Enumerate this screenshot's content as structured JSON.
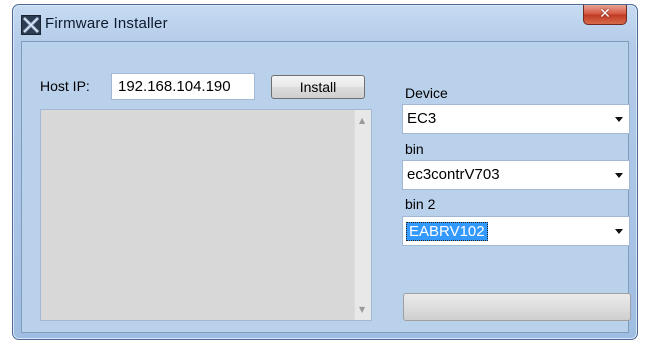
{
  "window": {
    "title": "Firmware Installer",
    "close_glyph": "✕"
  },
  "host": {
    "label": "Host IP:",
    "value": "192.168.104.190"
  },
  "install_button": {
    "label": "Install"
  },
  "device": {
    "label": "Device",
    "selected": "EC3"
  },
  "bin": {
    "label": "bin",
    "selected": "ec3contrV703"
  },
  "bin2": {
    "label": "bin 2",
    "selected": "EABRV102"
  },
  "progress": {
    "value": 0
  },
  "icons": {
    "app": "app-logo-icon",
    "scroll_up": "▲",
    "scroll_down": "▼"
  },
  "colors": {
    "window_client": "#b9d1ea",
    "selection": "#3399ff",
    "close_button": "#c03a24"
  }
}
